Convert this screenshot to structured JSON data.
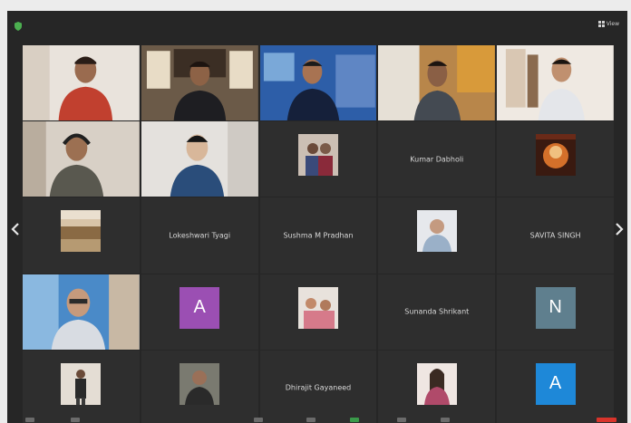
{
  "toolbar": {
    "view_label": "View"
  },
  "tiles": [
    {
      "name": "",
      "kind": "video",
      "scene": "red"
    },
    {
      "name": "",
      "kind": "video",
      "scene": "shelf"
    },
    {
      "name": "",
      "kind": "video",
      "scene": "blue"
    },
    {
      "name": "",
      "kind": "video",
      "scene": "orange"
    },
    {
      "name": "",
      "kind": "video",
      "scene": "white"
    },
    {
      "name": "",
      "kind": "video",
      "scene": "headset"
    },
    {
      "name": "",
      "kind": "video",
      "scene": "navy"
    },
    {
      "name": "",
      "kind": "photo",
      "photo": "people"
    },
    {
      "name": "",
      "kind": "text",
      "display": "Kumar Dabholi"
    },
    {
      "name": "",
      "kind": "photo",
      "photo": "warm"
    },
    {
      "name": "",
      "kind": "photo",
      "photo": "landscape"
    },
    {
      "name": "",
      "kind": "text",
      "display": "Lokeshwari Tyagi"
    },
    {
      "name": "",
      "kind": "text",
      "display": "Sushma M Pradhan"
    },
    {
      "name": "",
      "kind": "photo",
      "photo": "portrait"
    },
    {
      "name": "",
      "kind": "text",
      "display": "SAVITA SINGH"
    },
    {
      "name": "",
      "kind": "video",
      "scene": "glasses"
    },
    {
      "name": "",
      "kind": "letter",
      "letter": "A",
      "color": "#9b4fb3"
    },
    {
      "name": "",
      "kind": "photo",
      "photo": "group"
    },
    {
      "name": "",
      "kind": "text",
      "display": "Sunanda Shrikant"
    },
    {
      "name": "",
      "kind": "letter",
      "letter": "N",
      "color": "#5f7f8e"
    },
    {
      "name": "",
      "kind": "photo",
      "photo": "standing"
    },
    {
      "name": "",
      "kind": "photo",
      "photo": "man"
    },
    {
      "name": "",
      "kind": "text",
      "display": "Dhirajit Gayaneed"
    },
    {
      "name": "",
      "kind": "photo",
      "photo": "woman"
    },
    {
      "name": "",
      "kind": "letter",
      "letter": "A",
      "color": "#1e88d8"
    }
  ]
}
